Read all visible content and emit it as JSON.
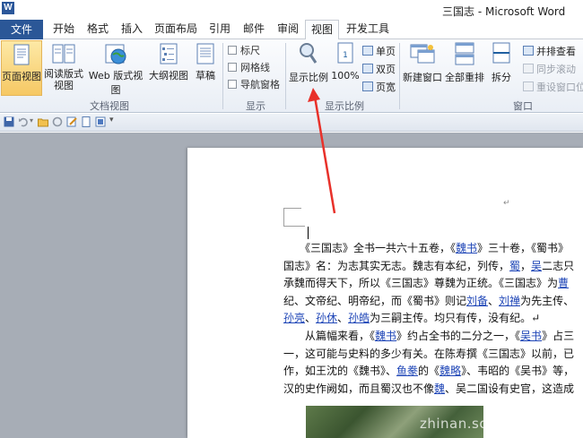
{
  "window": {
    "app_icon": "W",
    "title": "三国志 - Microsoft Word"
  },
  "tabs": [
    {
      "label": "文件"
    },
    {
      "label": "开始"
    },
    {
      "label": "格式"
    },
    {
      "label": "插入"
    },
    {
      "label": "页面布局"
    },
    {
      "label": "引用"
    },
    {
      "label": "邮件"
    },
    {
      "label": "审阅"
    },
    {
      "label": "视图"
    },
    {
      "label": "开发工具"
    }
  ],
  "ribbon": {
    "doc_views": {
      "group_label": "文档视图",
      "page_view": "页面视图",
      "read_view_line1": "阅读版式",
      "read_view_line2": "视图",
      "web_view": "Web 版式视图",
      "outline": "大纲视图",
      "draft": "草稿"
    },
    "show": {
      "group_label": "显示",
      "ruler": "标尺",
      "gridlines": "网格线",
      "nav_pane": "导航窗格"
    },
    "zoom": {
      "group_label": "显示比例",
      "zoom": "显示比例",
      "hundred": "100%",
      "one_page": "单页",
      "two_pages": "双页",
      "page_width": "页宽"
    },
    "window": {
      "group_label": "窗口",
      "new_window": "新建窗口",
      "arrange_all": "全部重排",
      "split": "拆分",
      "side_by_side": "并排查看",
      "sync_scroll": "同步滚动",
      "reset_position": "重设窗口位"
    }
  },
  "colors": {
    "file_tab": "#2b5797",
    "highlight": "#f6c864",
    "link": "#1f46b7",
    "arrow": "#e8312a"
  },
  "document": {
    "lines": [
      [
        "　　《三国志》全书一共六十五卷，《",
        {
          "link": "魏书"
        },
        "》三十卷，《蜀书》"
      ],
      [
        "国志》名：为志其实无志。魏志有本纪，列传，",
        {
          "link": "蜀"
        },
        "，",
        {
          "link": "吴"
        },
        "二志只"
      ],
      [
        "承魏而得天下，所以《三国志》尊魏为正统。《三国志》为",
        {
          "link": "曹"
        }
      ],
      [
        "纪、文帝纪、明帝纪，而《蜀书》则记",
        {
          "link": "刘备"
        },
        "、",
        {
          "link": "刘禅"
        },
        "为先主传、"
      ],
      [
        {
          "link": "孙亮"
        },
        "、",
        {
          "link": "孙休"
        },
        "、",
        {
          "link": "孙皓"
        },
        "为三嗣主传。均只有传，没有纪。↵"
      ],
      [
        "　　从篇幅来看，《",
        {
          "link": "魏书"
        },
        "》约占全书的二分之一，《",
        {
          "link": "吴书"
        },
        "》占三"
      ],
      [
        "一，这可能与史料的多少有关。在陈寿撰《三国志》以前，已"
      ],
      [
        "作，如王沈的《魏书》、",
        {
          "link": "鱼豢"
        },
        "的《",
        {
          "link": "魏略"
        },
        "》、韦昭的《吴书》等，"
      ],
      [
        "汉的史作阙如，而且蜀汉也不像",
        {
          "link": "魏"
        },
        "、吴二国设有史官，这造成"
      ]
    ],
    "watermark": "zhinan.sogou.com"
  }
}
